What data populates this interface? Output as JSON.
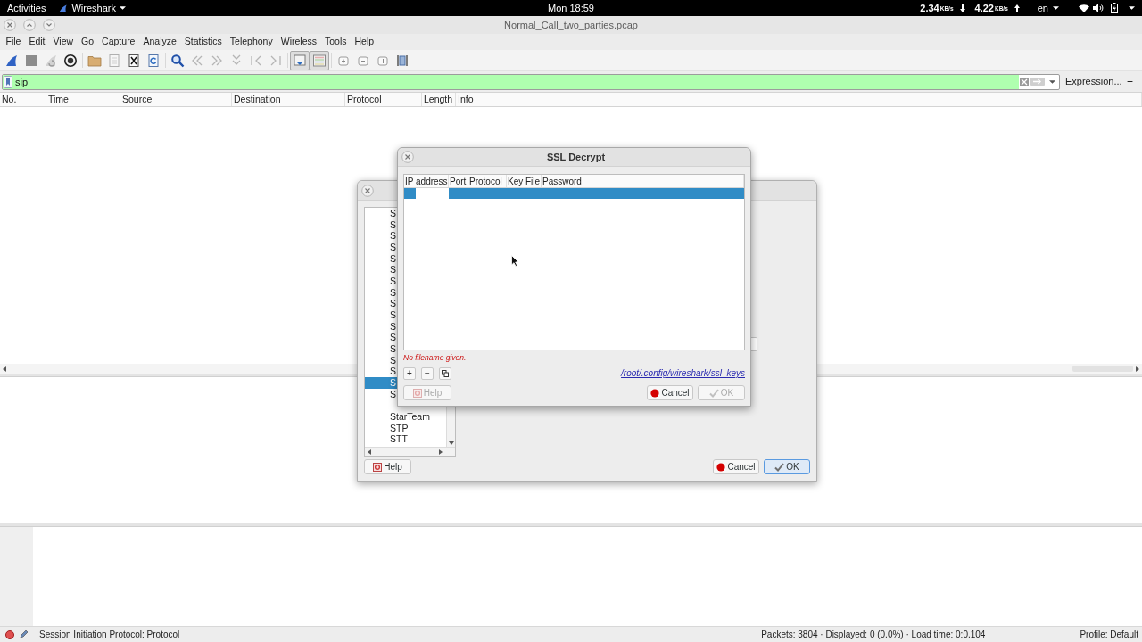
{
  "top_bar": {
    "activities": "Activities",
    "app_name": "Wireshark",
    "clock": "Mon 18:59",
    "network": [
      {
        "kind": "down",
        "value": "2.34",
        "unit": "KB/s"
      },
      {
        "kind": "up",
        "value": "4.22",
        "unit": "KB/s"
      }
    ],
    "language": "en"
  },
  "window": {
    "title": "Normal_Call_two_parties.pcap"
  },
  "menu": [
    "File",
    "Edit",
    "View",
    "Go",
    "Capture",
    "Analyze",
    "Statistics",
    "Telephony",
    "Wireless",
    "Tools",
    "Help"
  ],
  "toolbar": [
    {
      "pressed": false
    },
    {
      "pressed": false
    },
    {
      "pressed": false
    },
    {
      "pressed": false
    },
    {
      "pressed": false
    },
    {
      "pressed": false
    },
    {
      "pressed": false
    },
    {
      "pressed": false
    },
    {
      "pressed": false
    },
    {
      "pressed": false
    },
    {
      "pressed": false
    },
    {
      "pressed": false
    },
    {
      "pressed": false
    },
    {
      "pressed": false
    },
    {
      "pressed": true
    },
    {
      "pressed": true
    },
    {
      "pressed": false
    },
    {
      "pressed": false
    },
    {
      "pressed": false
    },
    {
      "pressed": false
    }
  ],
  "display_filter": {
    "value": "sip",
    "valid": true,
    "expression_button": "Expression...",
    "add_button": "+"
  },
  "packet_list": {
    "columns": [
      "No.",
      "Time",
      "Source",
      "Destination",
      "Protocol",
      "Length",
      "Info"
    ]
  },
  "preferences_dialog": {
    "list": [
      {
        "label": "S",
        "selected": false
      },
      {
        "label": "S",
        "selected": false
      },
      {
        "label": "S",
        "selected": false
      },
      {
        "label": "S",
        "selected": false
      },
      {
        "label": "S",
        "selected": false
      },
      {
        "label": "S",
        "selected": false
      },
      {
        "label": "S",
        "selected": false
      },
      {
        "label": "S",
        "selected": false
      },
      {
        "label": "S",
        "selected": false
      },
      {
        "label": "S",
        "selected": false
      },
      {
        "label": "S",
        "selected": false
      },
      {
        "label": "S",
        "selected": false
      },
      {
        "label": "S",
        "selected": false
      },
      {
        "label": "S",
        "selected": false
      },
      {
        "label": "S",
        "selected": false
      },
      {
        "label": "S",
        "selected": true
      },
      {
        "label": "S",
        "selected": false
      },
      {
        "selected": false
      },
      {
        "label": "StarTeam",
        "selected": false
      },
      {
        "label": "STP",
        "selected": false
      },
      {
        "label": "STT",
        "selected": false
      }
    ],
    "buttons": [
      {
        "kind": "help",
        "label": "Help",
        "focused": false
      },
      {
        "kind": "cancel",
        "label": "Cancel",
        "focused": false
      },
      {
        "kind": "ok",
        "label": "OK",
        "focused": true
      }
    ]
  },
  "ssl_decrypt_dialog": {
    "title": "SSL Decrypt",
    "columns": [
      "IP address",
      "Port",
      "Protocol",
      "Key File",
      "Password"
    ],
    "rows": [
      {
        "selected": true,
        "editing": true
      }
    ],
    "message": "No filename given.",
    "edit_buttons": [
      {
        "kind": "add",
        "label": "+"
      },
      {
        "kind": "remove",
        "label": "−"
      },
      {
        "kind": "copy"
      }
    ],
    "file_link": "/root/.config/wireshark/ssl_keys",
    "buttons": [
      {
        "kind": "help",
        "label": "Help",
        "disabled": true
      },
      {
        "kind": "cancel",
        "label": "Cancel",
        "disabled": false
      },
      {
        "kind": "ok",
        "label": "OK",
        "disabled": true
      }
    ]
  },
  "status_bar": {
    "message": "Session Initiation Protocol: Protocol",
    "stats": "Packets: 3804 · Displayed: 0 (0.0%) · Load time: 0:0.104",
    "profile": "Profile: Default"
  }
}
